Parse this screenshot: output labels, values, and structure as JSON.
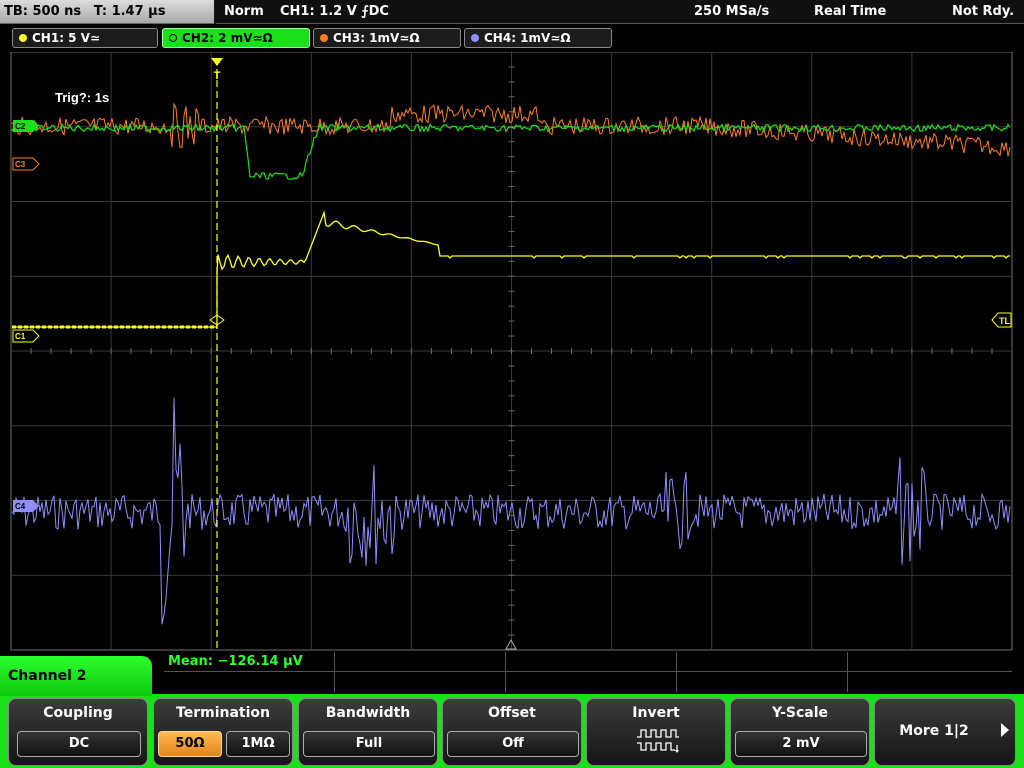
{
  "topbar": {
    "timebase": "TB: 500 ns",
    "trigger_time": "T: 1.47 µs",
    "trigger_mode": "Norm",
    "trigger_setting": "CH1: 1.2 V ⨍DC",
    "sample_rate": "250 MSa/s",
    "acq_mode": "Real Time",
    "ready_state": "Not Rdy."
  },
  "channels": [
    {
      "label": "CH1: 5 V≃",
      "color": "#ffff20"
    },
    {
      "label": "CH2: 2 mV≃Ω",
      "color": "#19e019"
    },
    {
      "label": "CH3: 1mV≃Ω",
      "color": "#ff7f20"
    },
    {
      "label": "CH4: 1mV≃Ω",
      "color": "#8f8fff"
    }
  ],
  "screen": {
    "trig_label": "Trig?: 1s",
    "markers": {
      "c3": "C3",
      "c1": "C1",
      "c4": "C4",
      "c2": "C2",
      "trigger_level": "TL",
      "trigger_pos": "T"
    }
  },
  "measurement": {
    "mean": "Mean: −126.14 µV"
  },
  "menu": {
    "title": "Channel 2",
    "coupling": {
      "title": "Coupling",
      "value": "DC"
    },
    "termination": {
      "title": "Termination",
      "opt1": "50Ω",
      "opt2": "1MΩ",
      "selected": "50Ω"
    },
    "bandwidth": {
      "title": "Bandwidth",
      "value": "Full"
    },
    "offset": {
      "title": "Offset",
      "value": "Off"
    },
    "invert": {
      "title": "Invert"
    },
    "yscale": {
      "title": "Y-Scale",
      "value": "2 mV"
    },
    "more": {
      "label": "More 1|2"
    }
  }
}
